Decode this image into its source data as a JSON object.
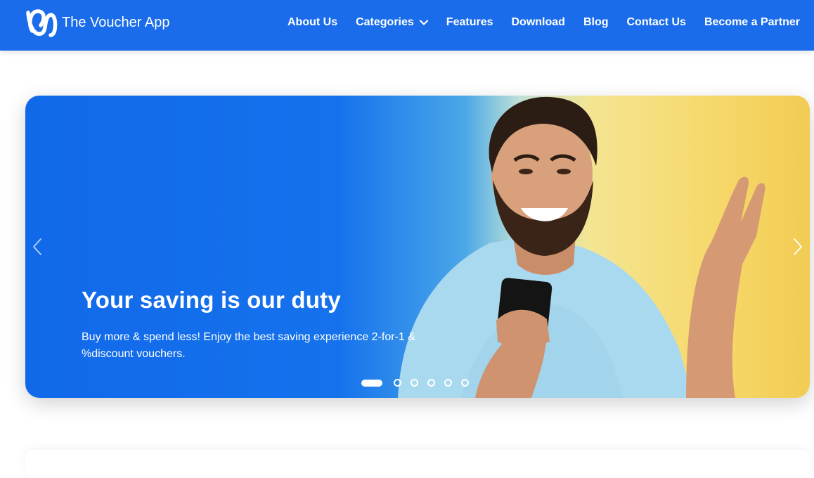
{
  "header": {
    "brand": "The Voucher App",
    "nav": [
      {
        "label": "About Us"
      },
      {
        "label": "Categories"
      },
      {
        "label": "Features"
      },
      {
        "label": "Download"
      },
      {
        "label": "Blog"
      },
      {
        "label": "Contact Us"
      },
      {
        "label": "Become a Partner"
      }
    ]
  },
  "hero": {
    "title": "Your saving is our duty",
    "subtitle": "Buy more & spend less! Enjoy the best saving experience 2-for-1 & %discount vouchers.",
    "slides": {
      "total": 6,
      "active": 1
    }
  },
  "colors": {
    "header": "#1a6cea",
    "hero_blue": "#1169ea",
    "hero_yellow": "#f2cc54"
  },
  "icons": [
    "voucher-logo-icon",
    "chevron-down-icon",
    "chevron-left-icon",
    "chevron-right-icon"
  ]
}
